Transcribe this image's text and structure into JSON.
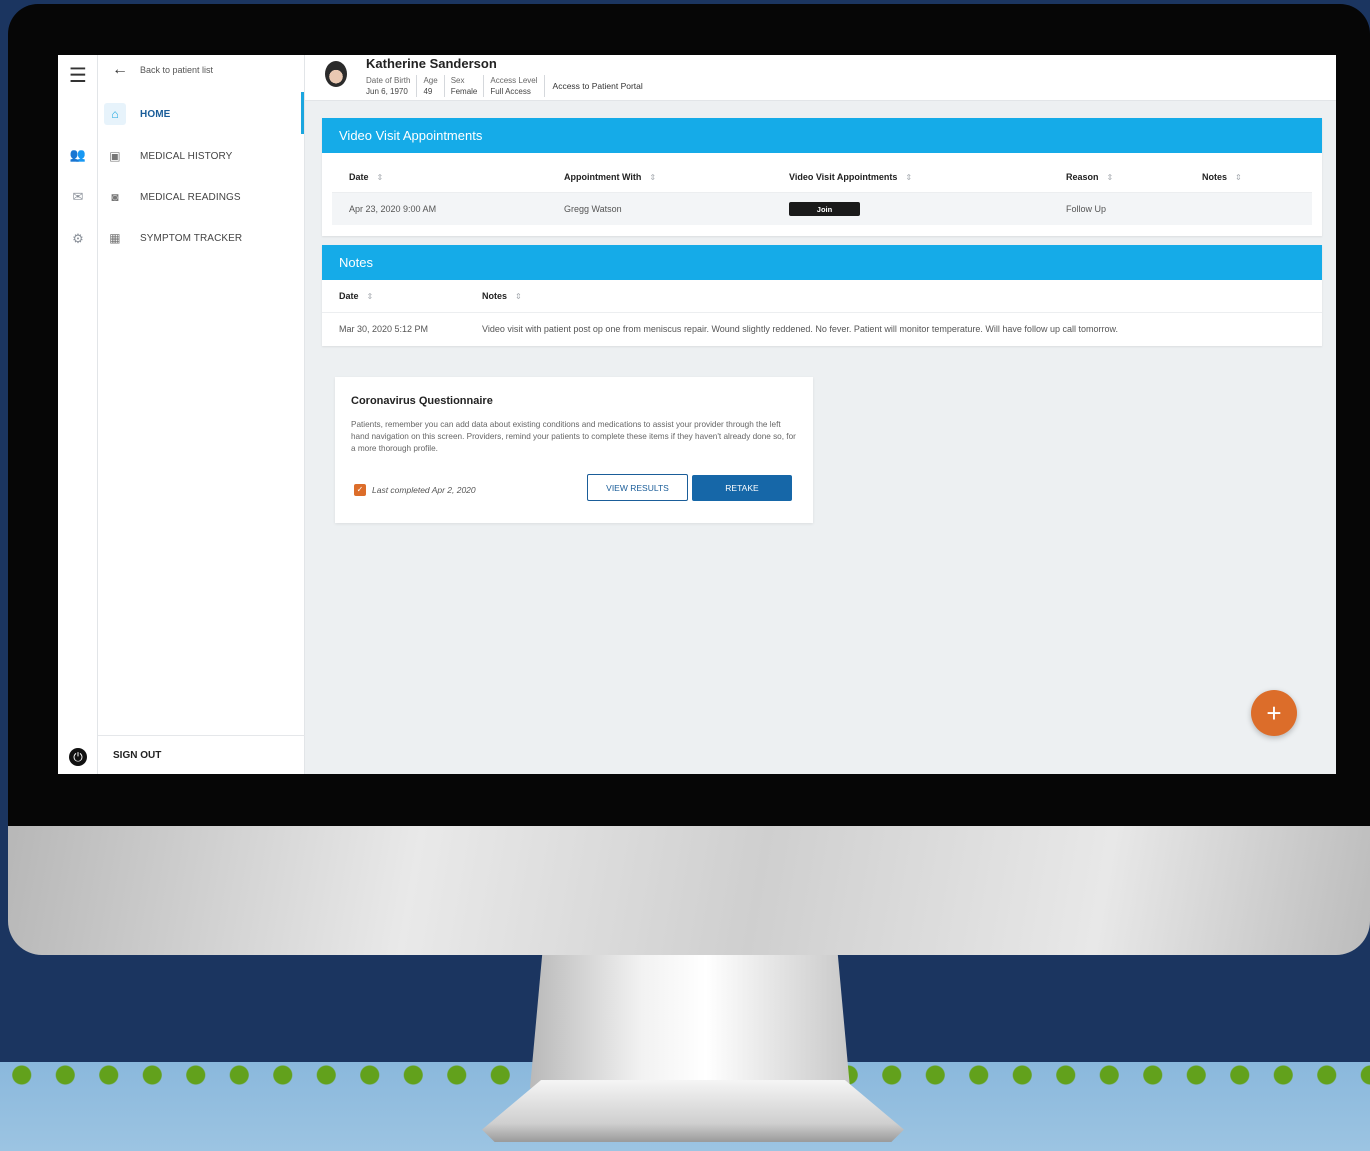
{
  "patient": {
    "name": "Katherine Sanderson",
    "dob_label": "Date of Birth",
    "dob": "Jun 6, 1970",
    "age_label": "Age",
    "age": "49",
    "sex_label": "Sex",
    "sex": "Female",
    "access_label": "Access Level",
    "access": "Full Access",
    "portal": "Access to Patient Portal"
  },
  "nav": {
    "back": "Back to patient list",
    "items": [
      {
        "label": "HOME",
        "icon": "home-icon"
      },
      {
        "label": "MEDICAL HISTORY",
        "icon": "clipboard-icon"
      },
      {
        "label": "MEDICAL READINGS",
        "icon": "medical-book-icon"
      },
      {
        "label": "SYMPTOM TRACKER",
        "icon": "grid-icon"
      }
    ],
    "signout": "SIGN OUT"
  },
  "appointments": {
    "title": "Video Visit Appointments",
    "columns": [
      "Date",
      "Appointment With",
      "Video Visit Appointments",
      "Reason",
      "Notes"
    ],
    "rows": [
      {
        "date": "Apr 23, 2020 9:00 AM",
        "with": "Gregg Watson",
        "action": "Join",
        "reason": "Follow Up",
        "notes": ""
      }
    ]
  },
  "notes": {
    "title": "Notes",
    "columns": [
      "Date",
      "Notes"
    ],
    "rows": [
      {
        "date": "Mar 30, 2020 5:12 PM",
        "text": "Video visit with patient post op one from meniscus repair. Wound slightly reddened. No fever. Patient will monitor temperature. Will have follow up call tomorrow."
      }
    ]
  },
  "questionnaire": {
    "title": "Coronavirus Questionnaire",
    "body": "Patients, remember you can add data about existing conditions and medications to assist your provider through the left hand navigation on this screen. Providers, remind your patients to complete these items if they haven't already done so, for a more thorough profile.",
    "last_completed": "Last completed Apr 2, 2020",
    "view_results": "VIEW RESULTS",
    "retake": "RETAKE"
  },
  "fab": {
    "label": "+"
  },
  "colors": {
    "accent": "#15abe8",
    "primary": "#1667a8",
    "fab": "#dc6d2a",
    "background": "#1b3560"
  }
}
